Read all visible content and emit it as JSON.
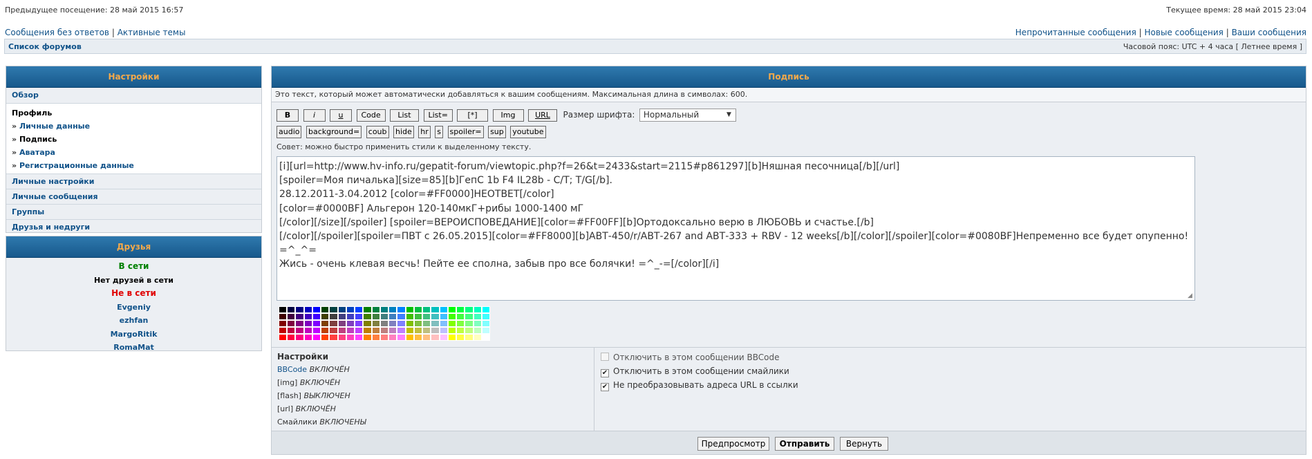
{
  "header": {
    "last_visit": "Предыдущее посещение: 28 май 2015 16:57",
    "current_time": "Текущее время: 28 май 2015 23:04",
    "left_links": [
      "Сообщения без ответов",
      "Активные темы"
    ],
    "right_links": [
      "Непрочитанные сообщения",
      "Новые сообщения",
      "Ваши сообщения"
    ],
    "separator": "|",
    "breadcrumb": "Список форумов",
    "timezone": "Часовой пояс: UTC + 4 часа [ Летнее время ]"
  },
  "sidebar": {
    "title": "Настройки",
    "overview": "Обзор",
    "profile_label": "Профиль",
    "profile_items": [
      "Личные данные",
      "Подпись",
      "Аватара",
      "Регистрационные данные"
    ],
    "active_item": "Подпись",
    "sections": [
      "Личные настройки",
      "Личные сообщения",
      "Группы",
      "Друзья и недруги"
    ]
  },
  "friends": {
    "title": "Друзья",
    "online_label": "В сети",
    "online_empty": "Нет друзей в сети",
    "offline_label": "Не в сети",
    "offline_list": [
      "Evgeniy",
      "ezhfan",
      "MargoRitik",
      "RomaMat"
    ],
    "colors": {
      "online": "#008000",
      "offline": "#e00000"
    }
  },
  "main": {
    "title": "Подпись",
    "description": "Это текст, который может автоматически добавляться к вашим сообщениям. Максимальная длина в символах: 600.",
    "toolbar": {
      "b": "B",
      "i": "i",
      "u": "u",
      "code": "Code",
      "list": "List",
      "list_eq": "List=",
      "star": "[*]",
      "img": "Img",
      "url": "URL",
      "font_size_label": "Размер шрифта:",
      "font_size_value": "Нормальный",
      "tags": [
        "audio",
        "background=",
        "coub",
        "hide",
        "hr",
        "s",
        "spoiler=",
        "sup",
        "youtube"
      ]
    },
    "tip": "Совет: можно быстро применить стили к выделенному тексту.",
    "signature_text": "[i][url=http://www.hv-info.ru/gepatit-forum/viewtopic.php?f=26&t=2433&start=2115#p861297][b]Няшная песочница[/b][/url]\n[spoiler=Моя пичалька][size=85][b]ГепС 1b F4 IL28b - C/T; T/G[/b].\n28.12.2011-3.04.2012 [color=#FF0000]НЕОТВЕТ[/color]\n[color=#0000BF] Альгерон 120-140мкГ+рибы 1000-1400 мГ\n[/color][/size][/spoiler] [spoiler=ВЕРОИСПОВЕДАНИЕ][color=#FF00FF][b]Ортодоксально верю в ЛЮБОВЬ и счастье.[/b]\n[/color][/spoiler][spoiler=ПВТ с 26.05.2015][color=#FF8000][b]АВТ-450/r/АВТ-267 and АВТ-333 + RBV - 12 weeks[/b][/color][/spoiler][color=#0080BF]Непременно все будет опупенно! =^_^=\nЖись - очень клевая весчь! Пейте ее сполна, забыв про все болячки! =^_-=[/color][/i]",
    "settings": {
      "title": "Настройки",
      "bbcode_link": "BBCode",
      "bbcode_state": "ВКЛЮЧЁН",
      "img_label": "[img]",
      "img_state": "ВКЛЮЧЁН",
      "flash_label": "[flash]",
      "flash_state": "ВЫКЛЮЧЕН",
      "url_label": "[url]",
      "url_state": "ВКЛЮЧЁН",
      "smilies_label": "Смайлики",
      "smilies_state": "ВКЛЮЧЕНЫ"
    },
    "options": [
      {
        "label": "Отключить в этом сообщении BBCode",
        "checked": false
      },
      {
        "label": "Отключить в этом сообщении смайлики",
        "checked": true
      },
      {
        "label": "Не преобразовывать адреса URL в ссылки",
        "checked": true
      }
    ],
    "checkmark": "✔",
    "buttons": {
      "preview": "Предпросмотр",
      "submit": "Отправить",
      "reset": "Вернуть"
    }
  },
  "colors": {
    "header_grad_top": "#2f79ae",
    "header_grad_bottom": "#17598c",
    "header_text": "#f5a94a",
    "link": "#105289",
    "panel_bg": "#eceff3"
  }
}
